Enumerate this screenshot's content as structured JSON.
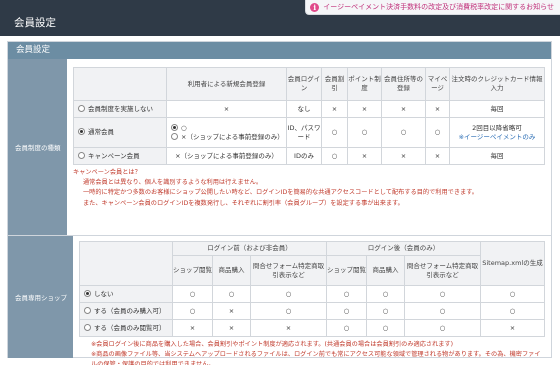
{
  "header": {
    "title": "会員設定",
    "notice": "イージーペイメント決済手数料の改定及び消費税率改定に関するお知らせ"
  },
  "panel": {
    "title": "会員設定"
  },
  "membership": {
    "label": "会員制度の種類",
    "headers": [
      "",
      "利用者による新規会員登録",
      "会員ログイン",
      "会員割引",
      "ポイント制度",
      "会員住所等の登録",
      "マイページ",
      "注文時のクレジットカード情報入力"
    ],
    "rows": [
      {
        "name": "会員制度を実施しない",
        "selected": false,
        "reg": "×",
        "login": "なし",
        "discount": "×",
        "point": "×",
        "address": "×",
        "mypage": "×",
        "card": "毎回"
      },
      {
        "name": "通常会員",
        "selected": true,
        "reg_opt1": "○",
        "reg_opt1_selected": true,
        "reg_opt2": "×（ショップによる事前登録のみ）",
        "reg_opt2_selected": false,
        "login": "ID、パスワード",
        "discount": "○",
        "point": "○",
        "address": "○",
        "mypage": "○",
        "card": "2回目以降省略可",
        "card_link": "※イージーペイメントのみ"
      },
      {
        "name": "キャンペーン会員",
        "selected": false,
        "reg": "×（ショップによる事前登録のみ）",
        "login": "IDのみ",
        "discount": "○",
        "point": "×",
        "address": "×",
        "mypage": "×",
        "card": "毎回"
      }
    ],
    "notes": [
      "キャンペーン会員とは？",
      "通常会員とは異なり、個人を識別するような利用は行えません。",
      "一時的に特定かつ多数のお客様にショップ公開したい時など、ログインIDを簡易的な共通アクセスコードとして配布する目的で利用できます。",
      "また、キャンペーン会員のログインIDを複数発行し、それぞれに割引率（会員グループ）を設定する事が出来ます。"
    ]
  },
  "memberShop": {
    "label": "会員専用ショップ",
    "group_before": "ログイン前（および非会員）",
    "group_after": "ログイン後（会員のみ）",
    "sitemap": "Sitemap.xmlの生成",
    "subheaders": [
      "ショップ閲覧",
      "商品購入",
      "問合せフォーム特定商取引表示など"
    ],
    "rows": [
      {
        "name": "しない",
        "selected": true,
        "cells": [
          "○",
          "○",
          "○",
          "○",
          "○",
          "○",
          "○"
        ]
      },
      {
        "name": "する（会員のみ購入可）",
        "selected": false,
        "cells": [
          "○",
          "×",
          "○",
          "○",
          "○",
          "○",
          "○"
        ]
      },
      {
        "name": "する（会員のみ閲覧可）",
        "selected": false,
        "cells": [
          "×",
          "×",
          "×",
          "○",
          "○",
          "○",
          "×"
        ]
      }
    ],
    "notes": [
      "※会員ログイン後に商品を購入した場合、会員割引やポイント制度が適応されます。(共通会員の場合は会員割引のみ適応されます)",
      "※商品の画像ファイル等、当システムへアップロードされるファイルは、ログイン前でも常にアクセス可能な領域で管理される物があります。その為、機密ファイルの保管・保護の目的では利用できません。"
    ]
  },
  "colors": {
    "header_bg": "#2f3a47",
    "panel_head": "#6c8da3",
    "row_label": "#7f97aa",
    "note_red": "#c0392b",
    "link_blue": "#2a6db5",
    "notice_pink": "#c0307a"
  }
}
